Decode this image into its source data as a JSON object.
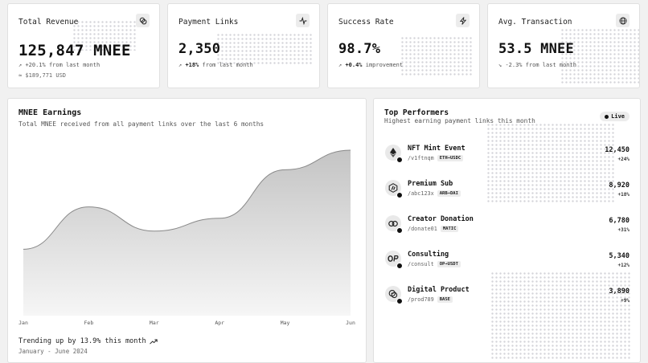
{
  "stats": [
    {
      "title": "Total Revenue",
      "icon": "coins-icon",
      "value": "125,847 MNEE",
      "change_arrow": "↗",
      "change_bold": "",
      "change_text": "+20.1% from last month",
      "sub": "≈ $189,771 USD"
    },
    {
      "title": "Payment Links",
      "icon": "activity-icon",
      "value": "2,350",
      "change_arrow": "↗",
      "change_bold": "+18%",
      "change_text": "from last month",
      "sub": ""
    },
    {
      "title": "Success Rate",
      "icon": "zap-icon",
      "value": "98.7%",
      "change_arrow": "↗",
      "change_bold": "+0.4%",
      "change_text": "improvement",
      "sub": ""
    },
    {
      "title": "Avg. Transaction",
      "icon": "globe-icon",
      "value": "53.5 MNEE",
      "change_arrow": "↘",
      "change_bold": "",
      "change_text": "-2.3% from last month",
      "sub": ""
    }
  ],
  "earnings": {
    "title": "MNEE Earnings",
    "subtitle": "Total MNEE received from all payment links over the last 6 months",
    "trend_text": "Trending up by 13.9% this month",
    "range_text": "January - June 2024"
  },
  "chart_data": {
    "type": "area",
    "categories": [
      "Jan",
      "Feb",
      "Mar",
      "Apr",
      "May",
      "Jun"
    ],
    "values": [
      186,
      305,
      237,
      273,
      409,
      464
    ],
    "ylim": [
      0,
      500
    ],
    "grid": false,
    "color": "#888888"
  },
  "top": {
    "title": "Top Performers",
    "subtitle": "Highest earning payment links this month",
    "live_label": "Live",
    "items": [
      {
        "name": "NFT Mint Event",
        "slug": "/v1ftnqm",
        "pair": "ETH→USDC",
        "value": "12,450",
        "pct": "+24%",
        "icon": "ethereum-icon"
      },
      {
        "name": "Premium Sub",
        "slug": "/abc123x",
        "pair": "ARB→DAI",
        "value": "8,920",
        "pct": "+18%",
        "icon": "arbitrum-icon"
      },
      {
        "name": "Creator Donation",
        "slug": "/donate01",
        "pair": "MATIC",
        "value": "6,780",
        "pct": "+31%",
        "icon": "polygon-icon"
      },
      {
        "name": "Consulting",
        "slug": "/consult",
        "pair": "OP→USDT",
        "value": "5,340",
        "pct": "+12%",
        "icon": "optimism-icon"
      },
      {
        "name": "Digital Product",
        "slug": "/prod789",
        "pair": "BASE",
        "value": "3,890",
        "pct": "+9%",
        "icon": "base-icon"
      }
    ]
  }
}
